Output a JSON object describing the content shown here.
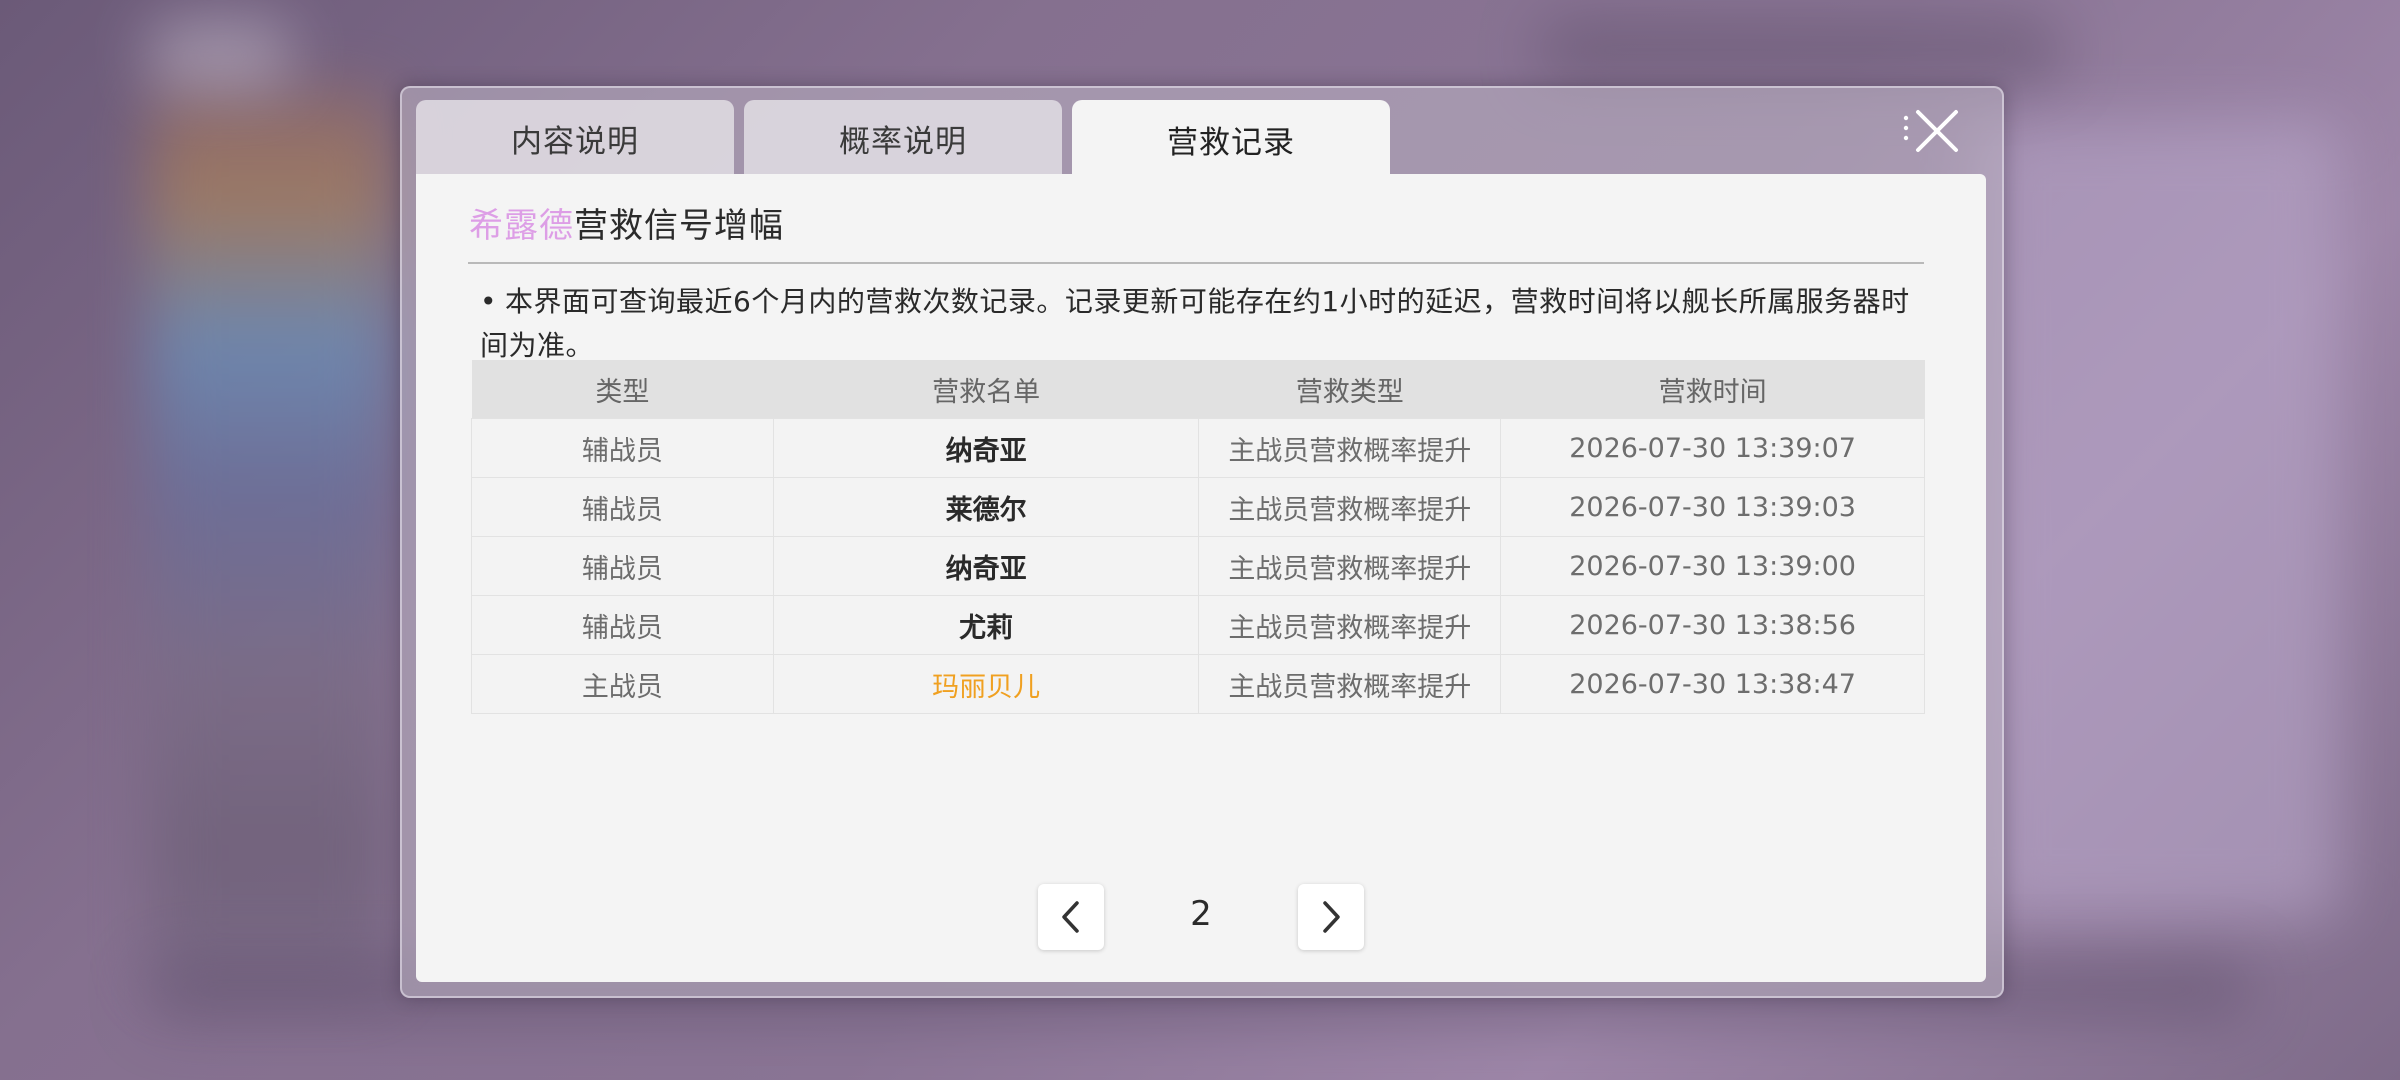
{
  "tabs": [
    {
      "label": "内容说明",
      "active": false
    },
    {
      "label": "概率说明",
      "active": false
    },
    {
      "label": "营救记录",
      "active": true
    }
  ],
  "panel": {
    "title_accent": "希露德",
    "title_rest": "营救信号增幅",
    "notice": "本界面可查询最近6个月内的营救次数记录。记录更新可能存在约1小时的延迟，营救时间将以舰长所属服务器时间为准。"
  },
  "table": {
    "headers": [
      "类型",
      "营救名单",
      "营救类型",
      "营救时间"
    ],
    "rows": [
      {
        "type": "辅战员",
        "name": "纳奇亚",
        "rescue_type": "主战员营救概率提升",
        "time": "2026-07-30 13:39:07"
      },
      {
        "type": "辅战员",
        "name": "莱德尔",
        "rescue_type": "主战员营救概率提升",
        "time": "2026-07-30 13:39:03"
      },
      {
        "type": "辅战员",
        "name": "纳奇亚",
        "rescue_type": "主战员营救概率提升",
        "time": "2026-07-30 13:39:00"
      },
      {
        "type": "辅战员",
        "name": "尤莉",
        "rescue_type": "主战员营救概率提升",
        "time": "2026-07-30 13:38:56"
      },
      {
        "type": "主战员",
        "name": "玛丽贝儿",
        "rescue_type": "主战员营救概率提升",
        "time": "2026-07-30 13:38:47"
      }
    ]
  },
  "pager": {
    "current_page": "2"
  },
  "colors": {
    "title_accent": "#dd9ee6",
    "highlight_name": "#f0a020",
    "panel_bg": "#f4f4f4"
  },
  "icons": {
    "close": "close-icon",
    "prev": "chevron-left-icon",
    "next": "chevron-right-icon"
  }
}
